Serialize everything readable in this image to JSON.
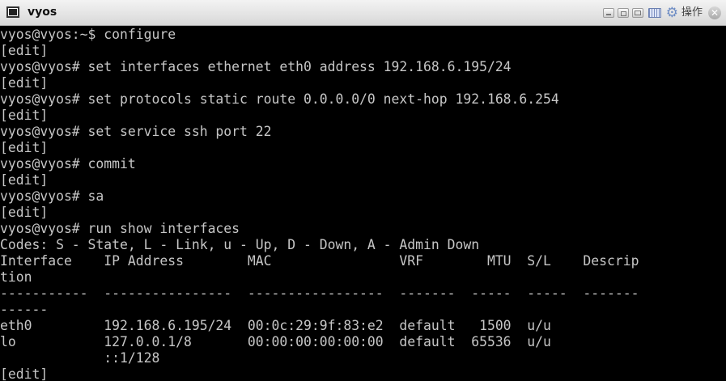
{
  "window": {
    "title": "vyos",
    "ops_label": "操作",
    "icons": [
      "terminal-app-icon",
      "minimize-icon",
      "restore-icon",
      "maximize-icon",
      "keyboard-icon",
      "gear-icon",
      "close-icon"
    ]
  },
  "terminal": {
    "lines": [
      "vyos@vyos:~$ configure",
      "[edit]",
      "vyos@vyos# set interfaces ethernet eth0 address 192.168.6.195/24",
      "[edit]",
      "vyos@vyos# set protocols static route 0.0.0.0/0 next-hop 192.168.6.254",
      "[edit]",
      "vyos@vyos# set service ssh port 22",
      "[edit]",
      "vyos@vyos# commit",
      "[edit]",
      "vyos@vyos# sa",
      "[edit]",
      "vyos@vyos# run show interfaces",
      "Codes: S - State, L - Link, u - Up, D - Down, A - Admin Down",
      "Interface    IP Address        MAC                VRF        MTU  S/L    Descrip",
      "tion",
      "-----------  ----------------  -----------------  -------  -----  -----  -------",
      "------",
      "eth0         192.168.6.195/24  00:0c:29:9f:83:e2  default   1500  u/u",
      "lo           127.0.0.1/8       00:00:00:00:00:00  default  65536  u/u",
      "             ::1/128",
      "[edit]"
    ]
  }
}
